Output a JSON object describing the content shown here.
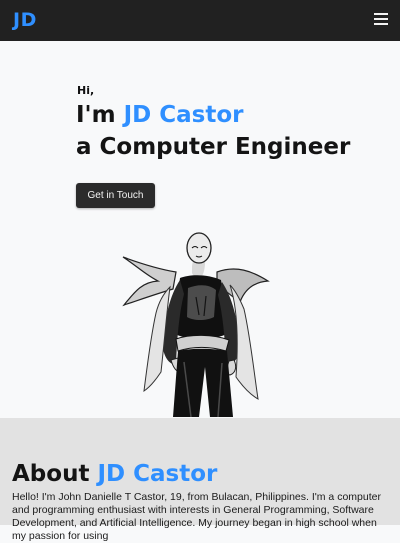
{
  "navbar": {
    "brand": "JD",
    "menu_icon": "hamburger-menu-icon"
  },
  "hero": {
    "greeting": "Hi,",
    "line1_prefix": "I'm ",
    "name": "JD Castor",
    "line2": "a Computer Engineer",
    "cta_label": "Get in Touch",
    "figure_icon": "caped-hero-illustration"
  },
  "about": {
    "title_prefix": "About ",
    "title_name": "JD Castor",
    "text": "Hello! I'm John Danielle T Castor, 19, from Bulacan, Philippines. I'm a computer and programming enthusiast with interests in General Programming, Software Development, and Artificial Intelligence. My journey began in high school when my passion for using"
  },
  "colors": {
    "accent": "#2f8fff",
    "navbar_bg": "#212121",
    "hero_bg": "#f8f9fa",
    "about_bg": "#e2e2e2",
    "button_bg": "#2b2b2b"
  }
}
